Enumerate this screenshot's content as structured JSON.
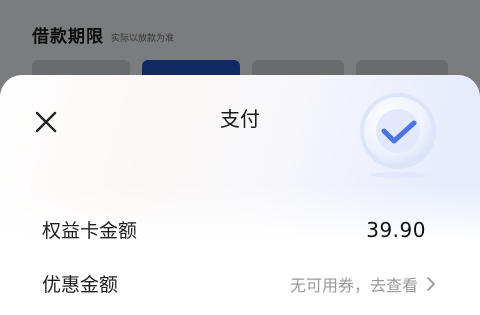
{
  "background": {
    "title": "借款期限",
    "subtitle": "实际以放款为准"
  },
  "sheet": {
    "title": "支付",
    "rows": [
      {
        "label": "权益卡金额",
        "value": "39.90"
      },
      {
        "label": "优惠金额",
        "link_text": "无可用券，去查看"
      }
    ]
  },
  "colors": {
    "accent": "#1f4fbf",
    "badge_check": "#4d74e6"
  },
  "icons": {
    "close": "close-icon",
    "badge": "check-badge-icon",
    "chevron": "chevron-right-icon"
  }
}
